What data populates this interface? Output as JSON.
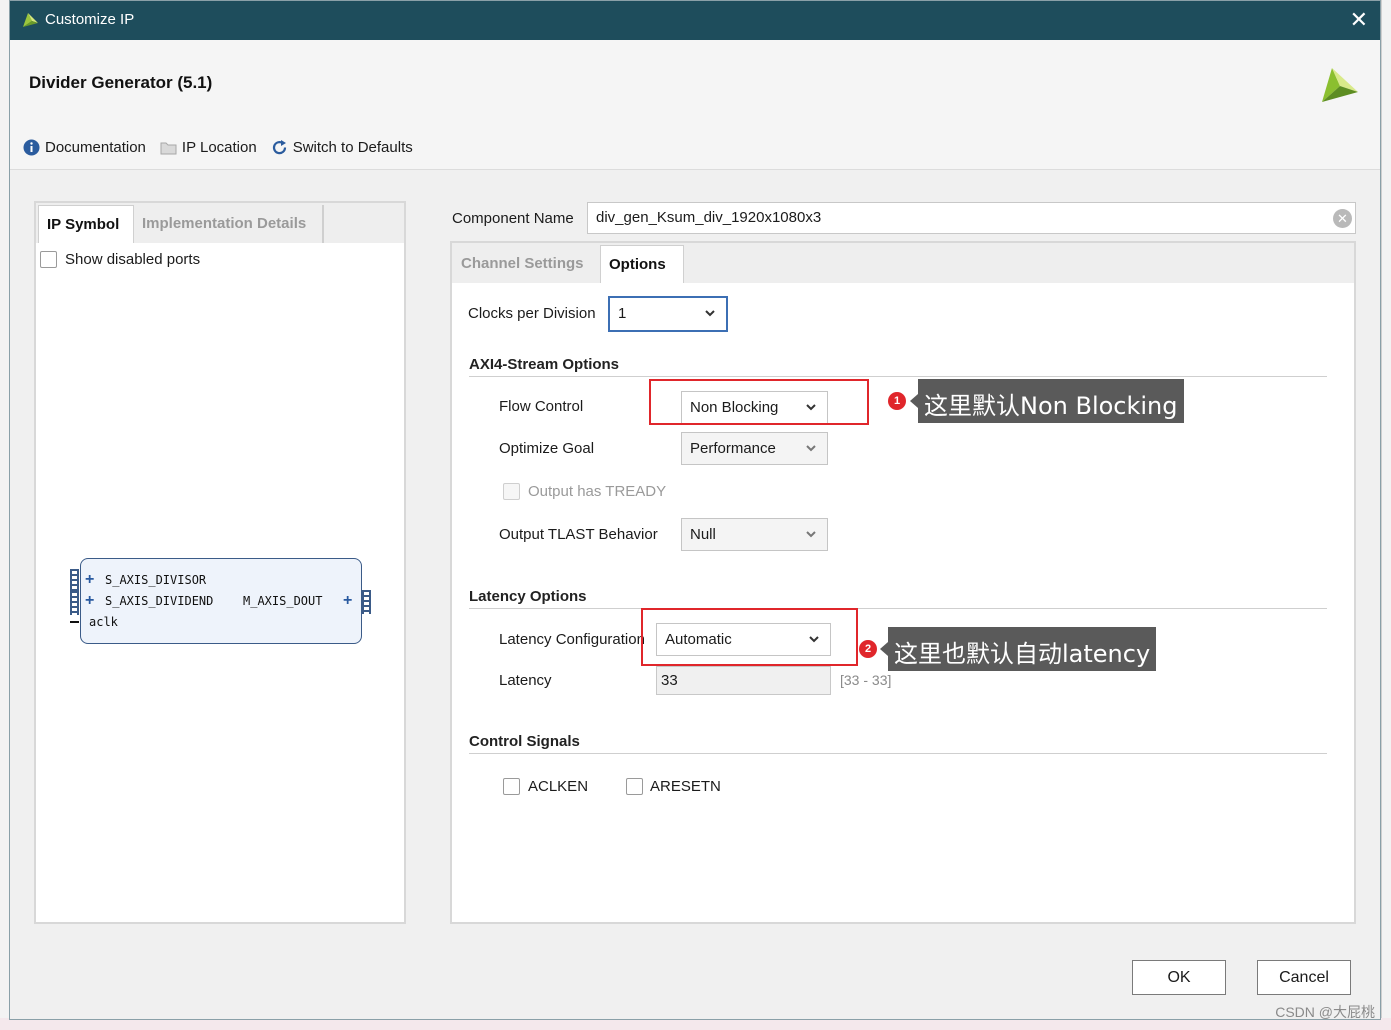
{
  "window": {
    "title": "Customize IP",
    "close_glyph": "✕"
  },
  "header": {
    "heading": "Divider Generator (5.1)"
  },
  "toolbar": {
    "documentation": "Documentation",
    "ip_location": "IP Location",
    "switch_defaults": "Switch to Defaults"
  },
  "left_panel": {
    "tabs": [
      "IP Symbol",
      "Implementation Details"
    ],
    "show_disabled_ports": "Show disabled ports",
    "symbol": {
      "port_divisor": "S_AXIS_DIVISOR",
      "port_dividend": "S_AXIS_DIVIDEND",
      "port_aclk": "aclk",
      "port_dout": "M_AXIS_DOUT",
      "plus": "+"
    }
  },
  "component": {
    "label": "Component Name",
    "value": "div_gen_Ksum_div_1920x1080x3",
    "clear_glyph": "✕"
  },
  "tabs": [
    "Channel Settings",
    "Options"
  ],
  "options": {
    "clocks_per_division": {
      "label": "Clocks per Division",
      "value": "1"
    },
    "axi4_stream": {
      "title": "AXI4-Stream Options",
      "flow_control": {
        "label": "Flow Control",
        "value": "Non Blocking"
      },
      "optimize_goal": {
        "label": "Optimize Goal",
        "value": "Performance"
      },
      "output_has_tready": {
        "label": "Output has TREADY",
        "checked": false
      },
      "output_tlast": {
        "label": "Output TLAST Behavior",
        "value": "Null"
      }
    },
    "latency": {
      "title": "Latency Options",
      "configuration": {
        "label": "Latency Configuration",
        "value": "Automatic"
      },
      "latency": {
        "label": "Latency",
        "value": "33",
        "range": "[33 - 33]"
      }
    },
    "control_signals": {
      "title": "Control Signals",
      "aclken": {
        "label": "ACLKEN",
        "checked": false
      },
      "aresetn": {
        "label": "ARESETN",
        "checked": false
      }
    }
  },
  "annotations": {
    "note1": {
      "number": "1",
      "text": "这里默认Non Blocking"
    },
    "note2": {
      "number": "2",
      "text": "这里也默认自动latency"
    },
    "highlight_color": "#e0262b"
  },
  "buttons": {
    "ok": "OK",
    "cancel": "Cancel"
  },
  "watermark": "CSDN @大屁桃",
  "colors": {
    "titlebar": "#1e4d5c",
    "focus": "#3c6fb4",
    "symbol_stroke": "#3b5b88"
  }
}
